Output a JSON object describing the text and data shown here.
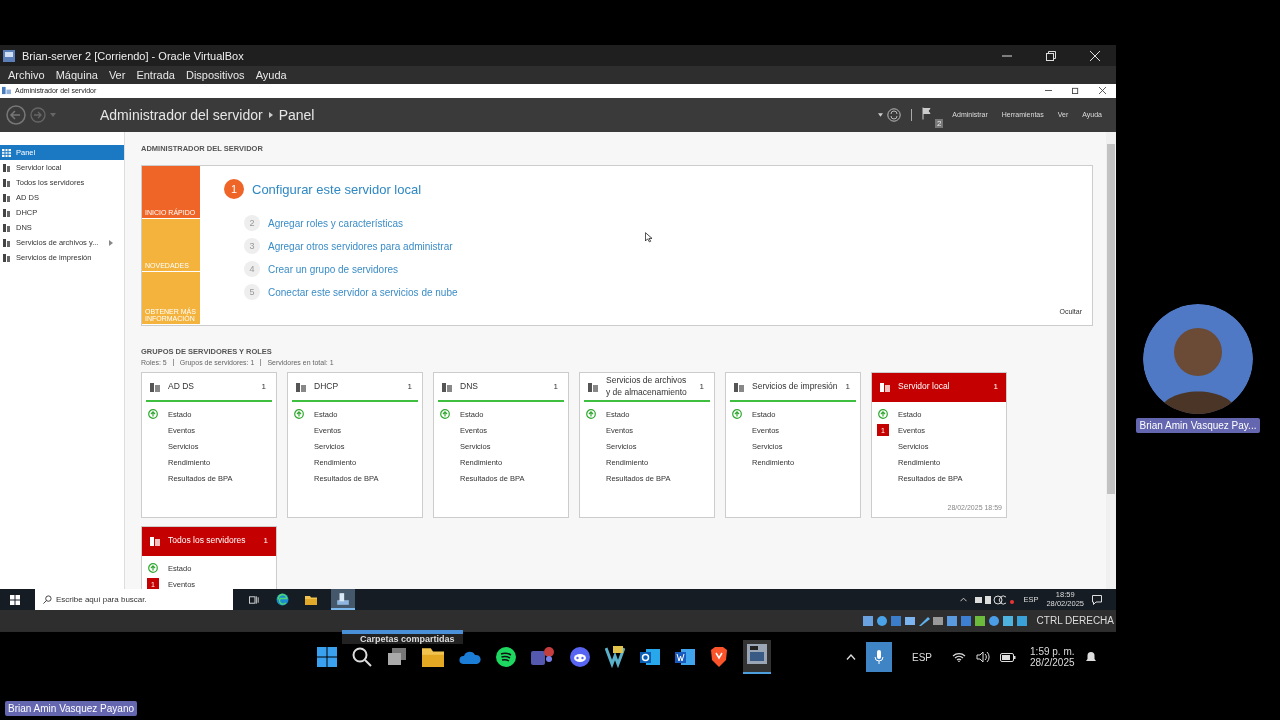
{
  "top_window": {
    "title": "Brian-server 2 [Corriendo] - Oracle VirtualBox"
  },
  "menu": [
    "Archivo",
    "Máquina",
    "Ver",
    "Entrada",
    "Dispositivos",
    "Ayuda"
  ],
  "app": {
    "title": "Administrador del servidor",
    "breadcrumb": [
      "Administrador del servidor",
      "Panel"
    ],
    "notifications": "2",
    "menus": [
      "Administrar",
      "Herramientas",
      "Ver",
      "Ayuda"
    ]
  },
  "sidebar": [
    {
      "label": "Panel",
      "selected": true,
      "has_submenu": false
    },
    {
      "label": "Servidor local",
      "selected": false,
      "has_submenu": false
    },
    {
      "label": "Todos los servidores",
      "selected": false,
      "has_submenu": false
    },
    {
      "label": "AD DS",
      "selected": false,
      "has_submenu": false
    },
    {
      "label": "DHCP",
      "selected": false,
      "has_submenu": false
    },
    {
      "label": "DNS",
      "selected": false,
      "has_submenu": false
    },
    {
      "label": "Servicios de archivos y...",
      "selected": false,
      "has_submenu": true
    },
    {
      "label": "Servicios de impresión",
      "selected": false,
      "has_submenu": false
    }
  ],
  "welcome": {
    "heading": "ADMINISTRADOR DEL SERVIDOR",
    "tabs": [
      {
        "label": "INICIO RÁPIDO",
        "selected": true
      },
      {
        "label": "NOVEDADES",
        "selected": false
      },
      {
        "label": "OBTENER MÁS INFORMACIÓN",
        "selected": false
      }
    ],
    "steps": [
      {
        "number": "1",
        "label": "Configurar este servidor local",
        "kind": "primary"
      },
      {
        "number": "2",
        "label": "Agregar roles y características",
        "kind": "secondary"
      },
      {
        "number": "3",
        "label": "Agregar otros servidores para administrar",
        "kind": "secondary"
      },
      {
        "number": "4",
        "label": "Crear un grupo de servidores",
        "kind": "secondary"
      },
      {
        "number": "5",
        "label": "Conectar este servidor a servicios de nube",
        "kind": "secondary"
      }
    ],
    "hide": "Ocultar"
  },
  "groups": {
    "heading": "GRUPOS DE SERVIDORES Y ROLES",
    "summary": [
      "Roles: 5",
      "Grupos de servidores: 1",
      "Servidores en total: 1"
    ],
    "tiles": [
      {
        "title": "AD DS",
        "count": "1",
        "alert": false,
        "items": [
          {
            "label": "Estado",
            "kind": "ok"
          },
          {
            "label": "Eventos",
            "kind": "plain"
          },
          {
            "label": "Servicios",
            "kind": "plain"
          },
          {
            "label": "Rendimiento",
            "kind": "plain"
          },
          {
            "label": "Resultados de BPA",
            "kind": "plain"
          }
        ]
      },
      {
        "title": "DHCP",
        "count": "1",
        "alert": false,
        "items": [
          {
            "label": "Estado",
            "kind": "ok"
          },
          {
            "label": "Eventos",
            "kind": "plain"
          },
          {
            "label": "Servicios",
            "kind": "plain"
          },
          {
            "label": "Rendimiento",
            "kind": "plain"
          },
          {
            "label": "Resultados de BPA",
            "kind": "plain"
          }
        ]
      },
      {
        "title": "DNS",
        "count": "1",
        "alert": false,
        "items": [
          {
            "label": "Estado",
            "kind": "ok"
          },
          {
            "label": "Eventos",
            "kind": "plain"
          },
          {
            "label": "Servicios",
            "kind": "plain"
          },
          {
            "label": "Rendimiento",
            "kind": "plain"
          },
          {
            "label": "Resultados de BPA",
            "kind": "plain"
          }
        ]
      },
      {
        "title": "Servicios de archivos y de almacenamiento",
        "count": "1",
        "alert": false,
        "items": [
          {
            "label": "Estado",
            "kind": "ok"
          },
          {
            "label": "Eventos",
            "kind": "plain"
          },
          {
            "label": "Servicios",
            "kind": "plain"
          },
          {
            "label": "Rendimiento",
            "kind": "plain"
          },
          {
            "label": "Resultados de BPA",
            "kind": "plain"
          }
        ]
      },
      {
        "title": "Servicios de impresión",
        "count": "1",
        "alert": false,
        "items": [
          {
            "label": "Estado",
            "kind": "ok"
          },
          {
            "label": "Eventos",
            "kind": "plain"
          },
          {
            "label": "Servicios",
            "kind": "plain"
          },
          {
            "label": "Rendimiento",
            "kind": "plain"
          }
        ]
      },
      {
        "title": "Servidor local",
        "count": "1",
        "alert": true,
        "items": [
          {
            "label": "Estado",
            "kind": "ok"
          },
          {
            "label": "Eventos",
            "kind": "alert",
            "badge": "1"
          },
          {
            "label": "Servicios",
            "kind": "plain"
          },
          {
            "label": "Rendimiento",
            "kind": "plain"
          },
          {
            "label": "Resultados de BPA",
            "kind": "plain"
          }
        ],
        "timestamp": "28/02/2025 18:59"
      },
      {
        "title": "Todos los servidores",
        "count": "1",
        "alert": true,
        "items": [
          {
            "label": "Estado",
            "kind": "ok"
          },
          {
            "label": "Eventos",
            "kind": "alert",
            "badge": "1"
          }
        ]
      }
    ]
  },
  "guest_taskbar": {
    "search_placeholder": "Escribe aquí para buscar.",
    "language": "ESP",
    "time": "18:59",
    "date": "28/02/2025"
  },
  "vm_status": {
    "host_key": "CTRL DERECHA"
  },
  "tooltip": "Carpetas compartidas",
  "host_taskbar": {
    "language": "ESP",
    "time": "1:59 p. m.",
    "date": "28/2/2025"
  },
  "participant": {
    "name": "Brian Amin Vasquez Pay..."
  },
  "caption": "Brian Amin Vasquez Payano"
}
